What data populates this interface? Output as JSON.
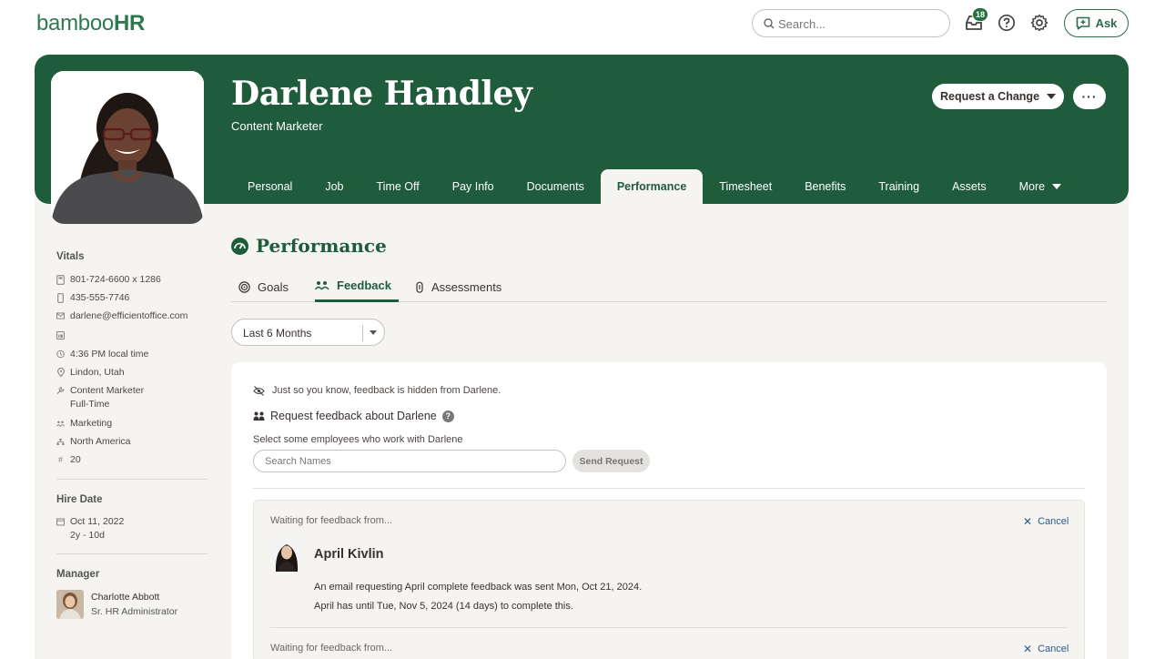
{
  "app": {
    "logo_main": "bamboo",
    "logo_accent": "HR"
  },
  "search": {
    "placeholder": "Search..."
  },
  "notifications": {
    "count": "18"
  },
  "ask": {
    "label": "Ask"
  },
  "employee": {
    "name": "Darlene Handley",
    "title": "Content Marketer"
  },
  "actions": {
    "request_change": "Request a Change",
    "more": "···"
  },
  "tabs": [
    {
      "label": "Personal"
    },
    {
      "label": "Job"
    },
    {
      "label": "Time Off"
    },
    {
      "label": "Pay Info"
    },
    {
      "label": "Documents"
    },
    {
      "label": "Performance",
      "active": true
    },
    {
      "label": "Timesheet"
    },
    {
      "label": "Benefits"
    },
    {
      "label": "Training"
    },
    {
      "label": "Assets"
    },
    {
      "label": "More"
    }
  ],
  "sidebar": {
    "vitals_heading": "Vitals",
    "work_phone": "801-724-6600 x 1286",
    "mobile_phone": "435-555-7746",
    "email": "darlene@efficientoffice.com",
    "local_time": "4:36 PM local time",
    "location": "Lindon, Utah",
    "job_title": "Content Marketer",
    "employment_type": "Full-Time",
    "department": "Marketing",
    "region": "North America",
    "employee_number": "20",
    "hire_date_heading": "Hire Date",
    "hire_date": "Oct 11, 2022",
    "tenure": "2y - 10d",
    "manager_heading": "Manager",
    "manager_name": "Charlotte Abbott",
    "manager_title": "Sr. HR Administrator"
  },
  "performance": {
    "heading": "Performance",
    "subtabs": [
      {
        "label": "Goals"
      },
      {
        "label": "Feedback",
        "active": true
      },
      {
        "label": "Assessments"
      }
    ],
    "period_selected": "Last 6 Months"
  },
  "feedback": {
    "hidden_note": "Just so you know, feedback is hidden from Darlene.",
    "request_heading": "Request feedback about Darlene",
    "select_label": "Select some employees who work with Darlene",
    "names_placeholder": "Search Names",
    "send_label": "Send Request",
    "waiting": [
      {
        "label": "Waiting for feedback from...",
        "cancel": "Cancel",
        "name": "April Kivlin",
        "sent_text": "An email requesting April complete feedback was sent Mon, Oct 21, 2024.",
        "deadline_text": "April has until Tue, Nov 5, 2024 (14 days) to complete this."
      },
      {
        "label": "Waiting for feedback from...",
        "cancel": "Cancel"
      }
    ]
  },
  "colors": {
    "brand_green": "#1f5c3b",
    "link_blue": "#2b5a8a",
    "background": "#f5f4f1"
  }
}
